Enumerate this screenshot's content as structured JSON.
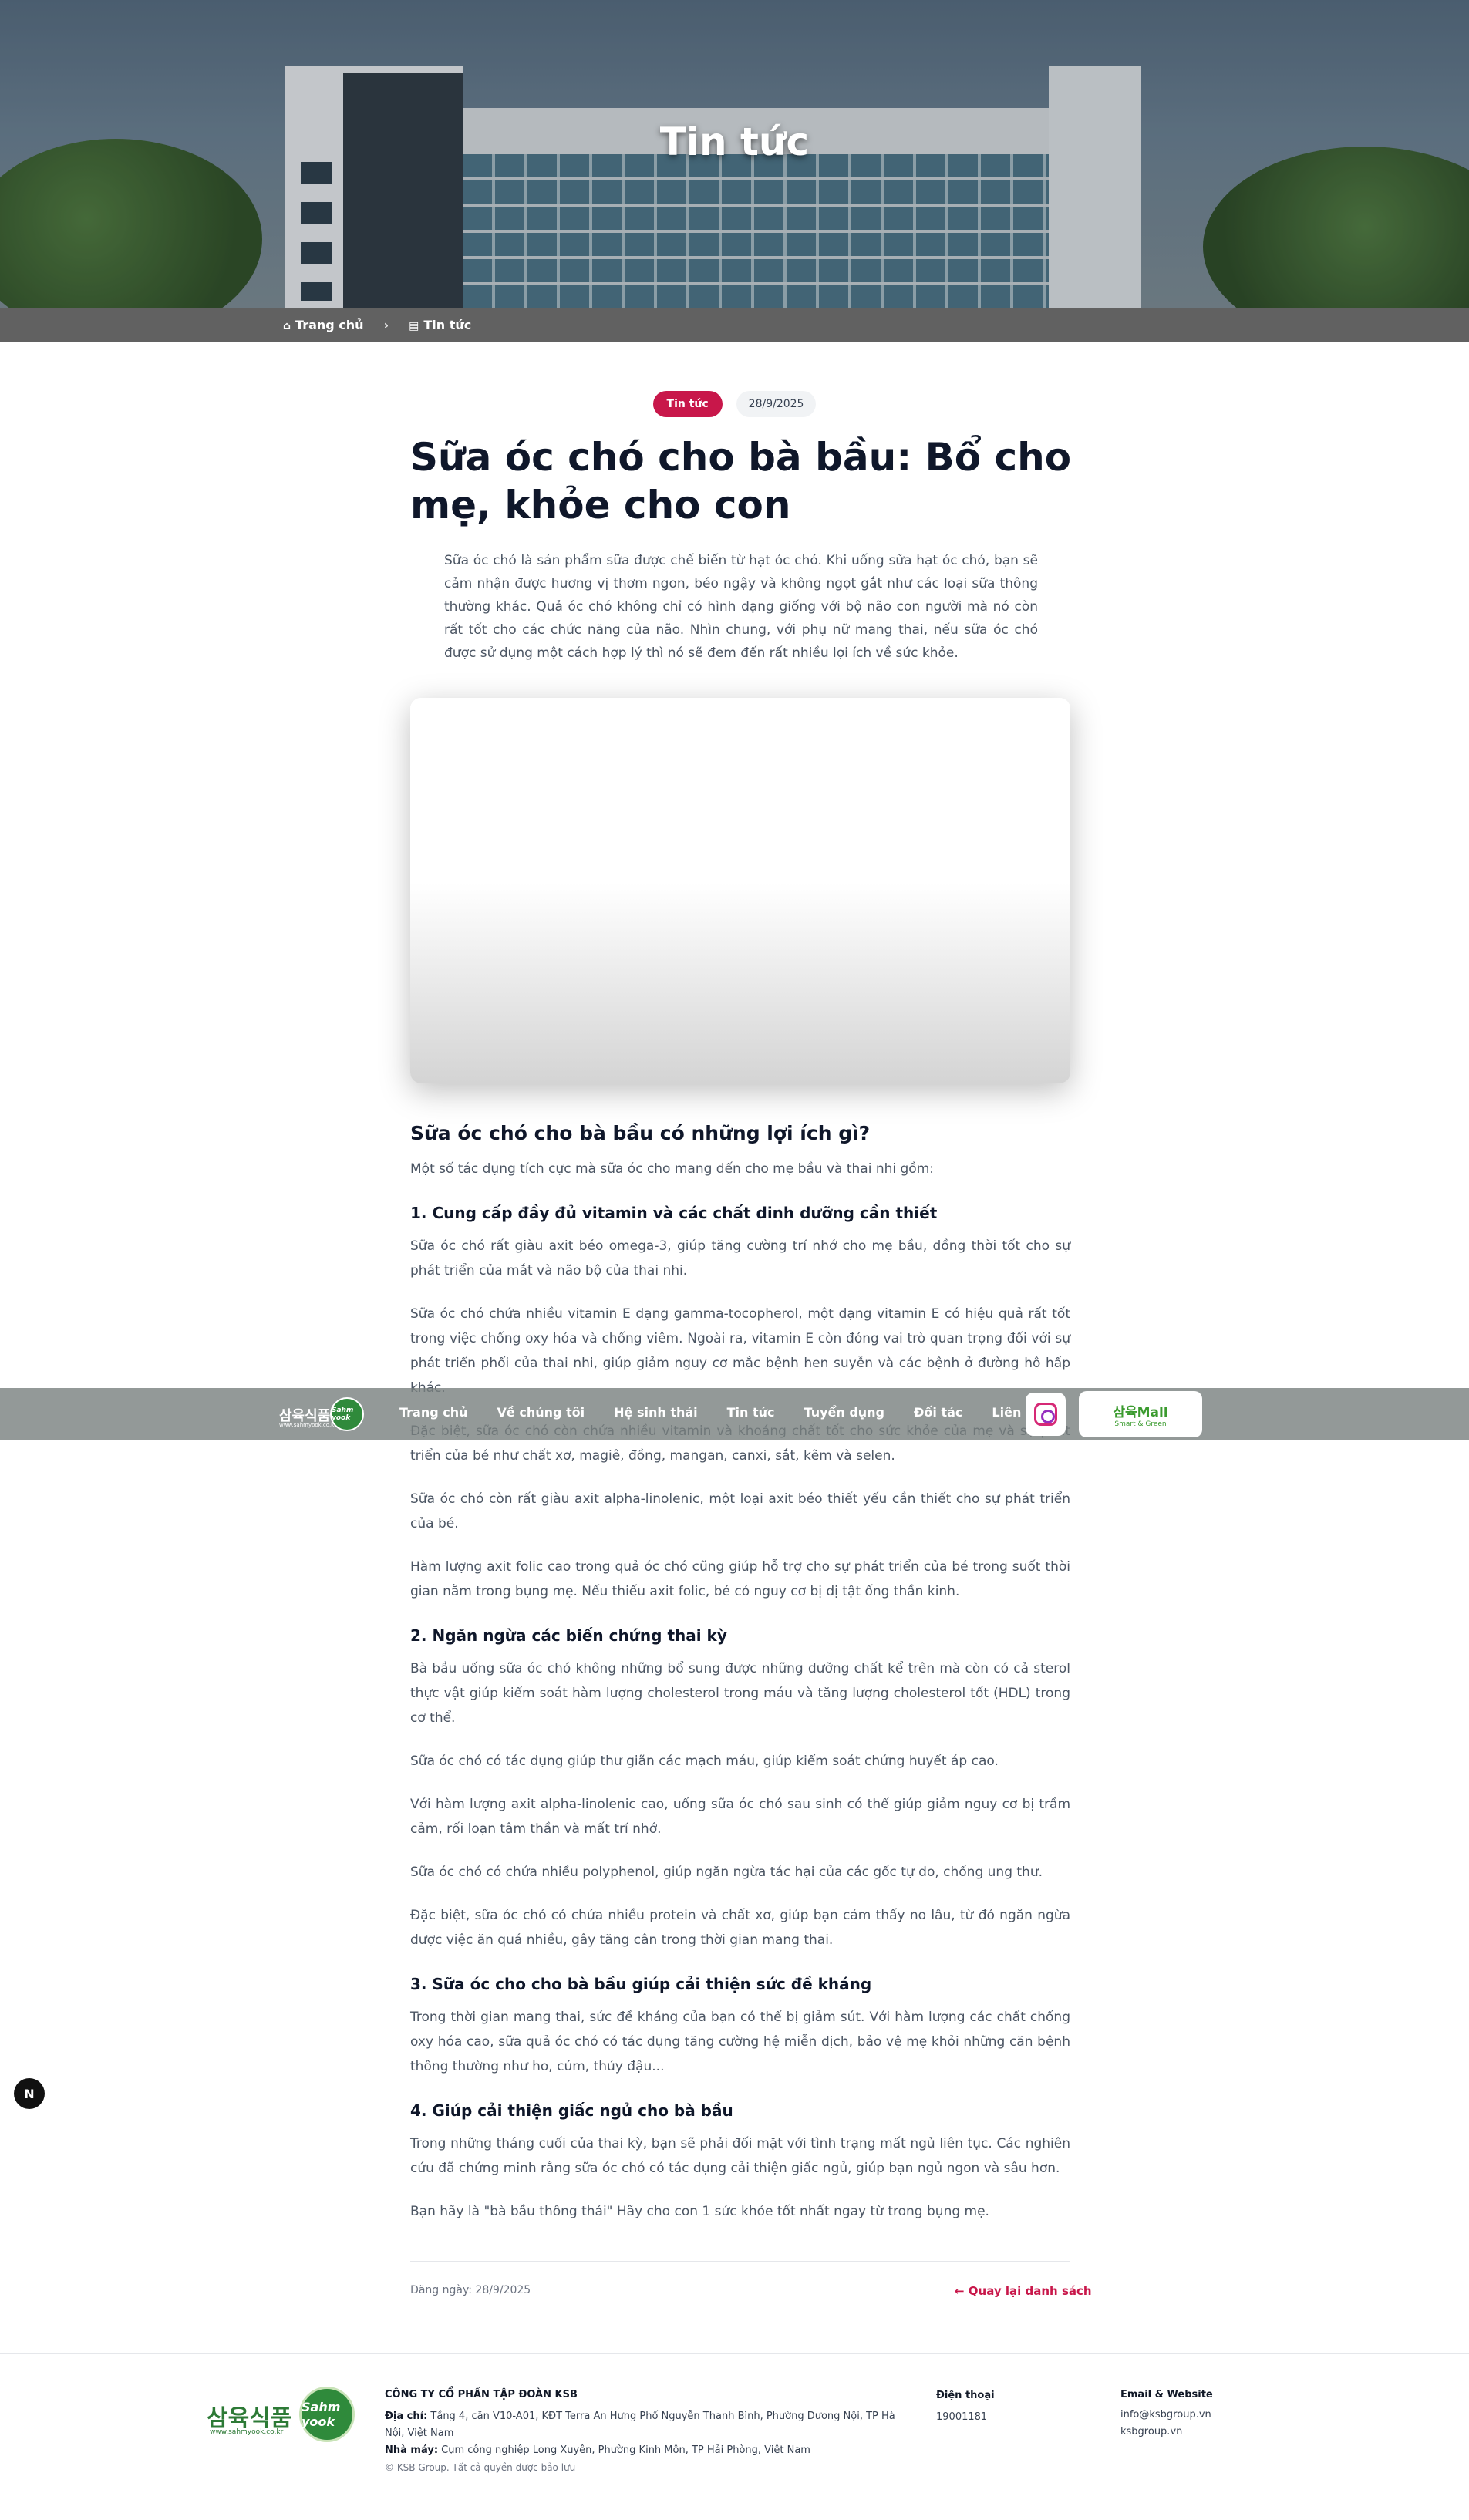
{
  "hero": {
    "title": "Tin tức"
  },
  "breadcrumb": {
    "home": "Trang chủ",
    "current": "Tin tức"
  },
  "article": {
    "category": "Tin tức",
    "date": "28/9/2025",
    "title": "Sữa óc chó cho bà bầu: Bổ cho mẹ, khỏe cho con",
    "lead": "Sữa óc chó là sản phẩm sữa được chế biến từ hạt óc chó. Khi uống sữa hạt óc chó, bạn sẽ cảm nhận được hương vị thơm ngon, béo ngậy và không ngọt gắt như các loại sữa thông thường khác. Quả óc chó không chỉ có hình dạng giống với bộ não con người mà nó còn rất tốt cho các chức năng của não. Nhìn chung, với phụ nữ mang thai, nếu sữa óc chó được sử dụng một cách hợp lý thì nó sẽ đem đến rất nhiều lợi ích về sức khỏe.",
    "h2": "Sữa óc chó cho bà bầu có những lợi ích gì?",
    "intro": "Một số tác dụng tích cực mà sữa óc cho mang đến cho mẹ bầu và thai nhi gồm:",
    "s1_title": "1. Cung cấp đầy đủ vitamin và các chất dinh dưỡng cần thiết",
    "s1_p1": "Sữa óc chó rất giàu axit béo omega-3, giúp tăng cường trí nhớ cho mẹ bầu, đồng thời tốt cho sự phát triển của mắt và não bộ của thai nhi.",
    "s1_p2": "Sữa óc chó chứa nhiều vitamin E dạng gamma-tocopherol, một dạng vitamin E có hiệu quả rất tốt trong việc chống oxy hóa và chống viêm. Ngoài ra, vitamin E còn đóng vai trò quan trọng đối với sự phát triển phổi của thai nhi, giúp giảm nguy cơ mắc bệnh hen suyễn và các bệnh ở đường hô hấp khác.",
    "s1_p3": "Đặc biệt, sữa óc chó còn chứa nhiều vitamin và khoáng chất tốt cho sức khỏe của mẹ và sự phát triển của bé như chất xơ, magiê, đồng, mangan, canxi, sắt, kẽm và selen.",
    "s1_p4": "Sữa óc chó còn rất giàu axit alpha-linolenic, một loại axit béo thiết yếu cần thiết cho sự phát triển của bé.",
    "s1_p5": "Hàm lượng axit folic cao trong quả óc chó cũng giúp hỗ trợ cho sự phát triển của bé trong suốt thời gian nằm trong bụng mẹ. Nếu thiếu axit folic, bé có nguy cơ bị dị tật ống thần kinh.",
    "s2_title": "2. Ngăn ngừa các biến chứng thai kỳ",
    "s2_p1": "Bà bầu uống sữa óc chó không những bổ sung được những dưỡng chất kể trên mà còn có cả sterol thực vật giúp kiểm soát hàm lượng cholesterol trong máu và tăng lượng cholesterol tốt (HDL) trong cơ thể.",
    "s2_p2": "Sữa óc chó có tác dụng giúp thư giãn các mạch máu, giúp kiểm soát chứng huyết áp cao.",
    "s2_p3": "Với hàm lượng axit alpha-linolenic cao, uống sữa óc chó sau sinh có thể giúp giảm nguy cơ bị trầm cảm, rối loạn tâm thần và mất trí nhớ.",
    "s2_p4": "Sữa óc chó có chứa nhiều polyphenol, giúp ngăn ngừa tác hại của các gốc tự do, chống ung thư.",
    "s2_p5": "Đặc biệt, sữa óc chó có chứa nhiều protein và chất xơ, giúp bạn cảm thấy no lâu, từ đó ngăn ngừa được việc ăn quá nhiều, gây tăng cân trong thời gian mang thai.",
    "s3_title": "3. Sữa óc cho cho bà bầu giúp cải thiện sức đề kháng",
    "s3_p1": "Trong thời gian mang thai, sức đề kháng của bạn có thể bị giảm sút. Với hàm lượng các chất chống oxy hóa cao, sữa quả óc chó có tác dụng tăng cường hệ miễn dịch, bảo vệ mẹ khỏi những căn bệnh thông thường như ho, cúm, thủy đậu...",
    "s4_title": "4. Giúp cải thiện giấc ngủ cho bà bầu",
    "s4_p1": "Trong những tháng cuối của thai kỳ, bạn sẽ phải đối mặt với tình trạng mất ngủ liên tục. Các nghiên cứu đã chứng minh rằng sữa óc chó có tác dụng cải thiện giấc ngủ, giúp bạn ngủ ngon và sâu hơn.",
    "closing": "Bạn hãy là \"bà bầu thông thái\" Hãy cho con 1 sức khỏe tốt nhất ngay từ trong bụng mẹ.",
    "posted_label": "Đăng ngày: 28/9/2025",
    "back_label": "Quay lại danh sách"
  },
  "nav": {
    "logo_text": "삼육식품",
    "logo_sub": "www.sahmyook.co.kr",
    "seal_text": "Sahm yook",
    "links": [
      "Trang chủ",
      "Về chúng tôi",
      "Hệ sinh thái",
      "Tin tức",
      "Tuyển dụng",
      "Đối tác",
      "Liên hệ"
    ],
    "mall_text": "삼육Mall",
    "mall_sub": "Smart & Green"
  },
  "next_badge": "N",
  "footer": {
    "logo_text": "삼육식품",
    "logo_sub": "www.sahmyook.co.kr",
    "seal_text": "Sahm yook",
    "company_name": "CÔNG TY CỔ PHẦN TẬP ĐOÀN KSB",
    "address_label": "Địa chỉ:",
    "address": "Tầng 4, căn V10-A01, KĐT Terra An Hưng Phố Nguyễn Thanh Bình, Phường Dương Nội, TP Hà Nội, Việt Nam",
    "factory_label": "Nhà máy:",
    "factory": "Cụm công nghiệp Long Xuyên, Phường Kinh Môn, TP Hải Phòng, Việt Nam",
    "copyright": "© KSB Group. Tất cả quyền được bảo lưu",
    "phone_label": "Điện thoại",
    "phone": "19001181",
    "email_label": "Email & Website",
    "email": "info@ksbgroup.vn",
    "website": "ksbgroup.vn"
  }
}
